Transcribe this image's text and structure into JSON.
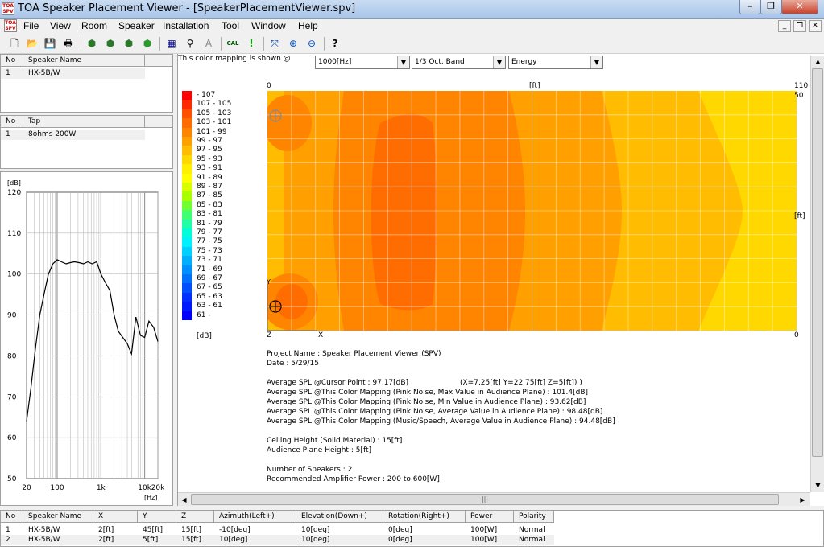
{
  "window": {
    "title": "TOA Speaker Placement Viewer - [SpeakerPlacementViewer.spv]",
    "app_icon": "TOA SPV"
  },
  "menu": [
    "File",
    "View",
    "Room",
    "Speaker",
    "Installation",
    "Tool",
    "Window",
    "Help"
  ],
  "toolbar_icons": [
    "new-file-icon",
    "open-folder-icon",
    "save-icon",
    "print-icon",
    "room-view-icon",
    "speaker-view-icon",
    "installation-view-icon",
    "cube-view-icon",
    "grid-icon",
    "place-speaker-icon",
    "aim-speaker-icon",
    "calculate-icon",
    "exclamation-icon",
    "fit-view-icon",
    "zoom-in-icon",
    "zoom-out-icon",
    "help-icon"
  ],
  "toolbar_cal": "CAL",
  "speaker_list": {
    "headers": [
      "No",
      "Speaker Name"
    ],
    "rows": [
      [
        "1",
        "HX-5B/W"
      ]
    ]
  },
  "tap_list": {
    "headers": [
      "No",
      "Tap"
    ],
    "rows": [
      [
        "1",
        "8ohms  200W"
      ]
    ]
  },
  "freq_chart": {
    "y_unit": "[dB]",
    "x_unit": "[Hz]",
    "y_ticks": [
      "120",
      "110",
      "100",
      "90",
      "80",
      "70",
      "60",
      "50"
    ],
    "x_ticks": [
      "20",
      "100",
      "1k",
      "10k",
      "20k"
    ]
  },
  "chart_data": {
    "type": "line",
    "title": "",
    "xlabel": "[Hz]",
    "ylabel": "[dB]",
    "x_scale": "log",
    "xlim": [
      20,
      20000
    ],
    "ylim": [
      50,
      120
    ],
    "grid": true,
    "series": [
      {
        "x": [
          20,
          25,
          32,
          40,
          50,
          63,
          80,
          100,
          125,
          160,
          200,
          250,
          315,
          400,
          500,
          630,
          800,
          1000,
          1250,
          1600,
          2000,
          2500,
          3150,
          4000,
          5000,
          6300,
          8000,
          10000,
          12500,
          16000,
          20000
        ],
        "values": [
          64,
          72,
          82,
          90,
          95,
          100,
          102.5,
          103.5,
          103,
          102.5,
          102.8,
          103,
          102.8,
          102.5,
          103,
          102.5,
          103,
          100,
          98,
          96,
          90,
          86,
          84.5,
          83,
          80.5,
          89.5,
          85,
          84.5,
          88.5,
          87,
          83.5
        ]
      }
    ]
  },
  "mapping_label": "This color mapping is shown @",
  "selects": {
    "freq": "1000[Hz]",
    "band": "1/3 Oct. Band",
    "mode": "Energy"
  },
  "legend": {
    "unit": "[dB]",
    "entries": [
      {
        "label": "- 107",
        "color": "#ff0000"
      },
      {
        "label": "107 - 105",
        "color": "#ff2a00"
      },
      {
        "label": "105 - 103",
        "color": "#ff5000"
      },
      {
        "label": "103 - 101",
        "color": "#ff6c00"
      },
      {
        "label": "101 - 99",
        "color": "#ff8400"
      },
      {
        "label": "99 - 97",
        "color": "#ffa000"
      },
      {
        "label": "97 - 95",
        "color": "#ffbc00"
      },
      {
        "label": "95 - 93",
        "color": "#ffd800"
      },
      {
        "label": "93 - 91",
        "color": "#fff000"
      },
      {
        "label": "91 - 89",
        "color": "#ffff00"
      },
      {
        "label": "89 - 87",
        "color": "#d8ff00"
      },
      {
        "label": "87 - 85",
        "color": "#a8ff00"
      },
      {
        "label": "85 - 83",
        "color": "#70ff30"
      },
      {
        "label": "83 - 81",
        "color": "#40ff70"
      },
      {
        "label": "81 - 79",
        "color": "#20ffa8"
      },
      {
        "label": "79 - 77",
        "color": "#00ffd8"
      },
      {
        "label": "77 - 75",
        "color": "#00f0ff"
      },
      {
        "label": "75 - 73",
        "color": "#00d0ff"
      },
      {
        "label": "73 - 71",
        "color": "#00b0ff"
      },
      {
        "label": "71 - 69",
        "color": "#0090ff"
      },
      {
        "label": "69 - 67",
        "color": "#0070ff"
      },
      {
        "label": "67 - 65",
        "color": "#0050ff"
      },
      {
        "label": "65 - 63",
        "color": "#0030ff"
      },
      {
        "label": "63 - 61",
        "color": "#0018ff"
      },
      {
        "label": "61 -",
        "color": "#0000ff"
      }
    ]
  },
  "map_axes": {
    "x_start": "0",
    "x_end": "110",
    "x_unit": "[ft]",
    "y_top": "50",
    "y_unit": "[ft]",
    "y_bottom": "0",
    "corner_z": "Z",
    "corner_x": "X",
    "corner_y": "Y"
  },
  "info": {
    "project": "Project Name : Speaker Placement Viewer (SPV)",
    "date": "Date : 5/29/15",
    "avg_cursor": "Average SPL @Cursor Point : 97.17[dB]",
    "cursor_pos": "(X=7.25[ft] Y=22.75[ft] Z=5[ft]) )",
    "avg_max": "Average SPL @This Color Mapping (Pink Noise, Max Value in Audience Plane) : 101.4[dB]",
    "avg_min": "Average SPL @This Color Mapping (Pink Noise, Min Value in Audience Plane) : 93.62[dB]",
    "avg_avg": "Average SPL @This Color Mapping (Pink Noise, Average Value in Audience Plane) : 98.48[dB]",
    "avg_music": "Average SPL @This Color Mapping (Music/Speech, Average Value in Audience Plane) : 94.48[dB]",
    "ceiling": "Ceiling Height (Solid Material) : 15[ft]",
    "audience": "Audience Plane Height : 5[ft]",
    "num_speakers": "Number of Speakers : 2",
    "amp_power": "Recommended Amplifier Power : 200 to 600[W]"
  },
  "bottom_table": {
    "headers": [
      "No",
      "Speaker Name",
      "X",
      "Y",
      "Z",
      "Azimuth(Left+)",
      "Elevation(Down+)",
      "Rotation(Right+)",
      "Power",
      "Polarity"
    ],
    "rows": [
      [
        "1",
        "HX-5B/W",
        "2[ft]",
        "45[ft]",
        "15[ft]",
        "-10[deg]",
        "10[deg]",
        "0[deg]",
        "100[W]",
        "Normal"
      ],
      [
        "2",
        "HX-5B/W",
        "2[ft]",
        "5[ft]",
        "15[ft]",
        "10[deg]",
        "10[deg]",
        "0[deg]",
        "100[W]",
        "Normal"
      ]
    ]
  }
}
